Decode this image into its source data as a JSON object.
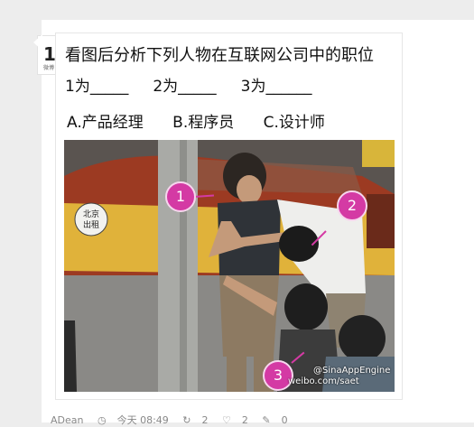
{
  "avatar": {
    "glyph": "1",
    "mini": "微博"
  },
  "question": {
    "title": "看图后分析下列人物在互联网公司中的职位",
    "blanks": "1为_____     2为_____     3为______",
    "options": "A.产品经理      B.程序员      C.设计师"
  },
  "photo": {
    "taxi_sign_line1": "北京",
    "taxi_sign_line2": "出租",
    "markers": [
      "1",
      "2",
      "3"
    ],
    "watermark_handle": "@SinaAppEngine",
    "watermark_url": "weibo.com/saet",
    "marker_color": "#d43aa4"
  },
  "meta": {
    "author": "ADean",
    "time": "今天 08:49",
    "reposts": "2",
    "likes": "2",
    "comments": "0"
  }
}
